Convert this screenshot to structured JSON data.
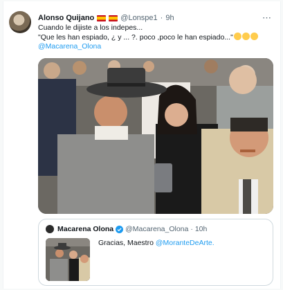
{
  "tweet": {
    "author_name": "Alonso Quijano",
    "author_handle": "@Lonspe1",
    "dot": "·",
    "time": "9h",
    "more_icon": "⋯",
    "line1": "Cuando le dijiste a los indepes...",
    "line2": "\"Que les han espiado, ¿ y ... ?. poco ,poco le han espiado...\"",
    "mention": "@Macarena_Olona"
  },
  "quoted": {
    "author_name": "Macarena Olona",
    "author_handle": "@Macarena_Olona",
    "dot": "·",
    "time": "10h",
    "text": "Gracias, Maestro ",
    "mention": "@MoranteDeArte."
  },
  "colors": {
    "link": "#1d9bf0",
    "verified": "#1d9bf0",
    "secondary_text": "#536471"
  }
}
